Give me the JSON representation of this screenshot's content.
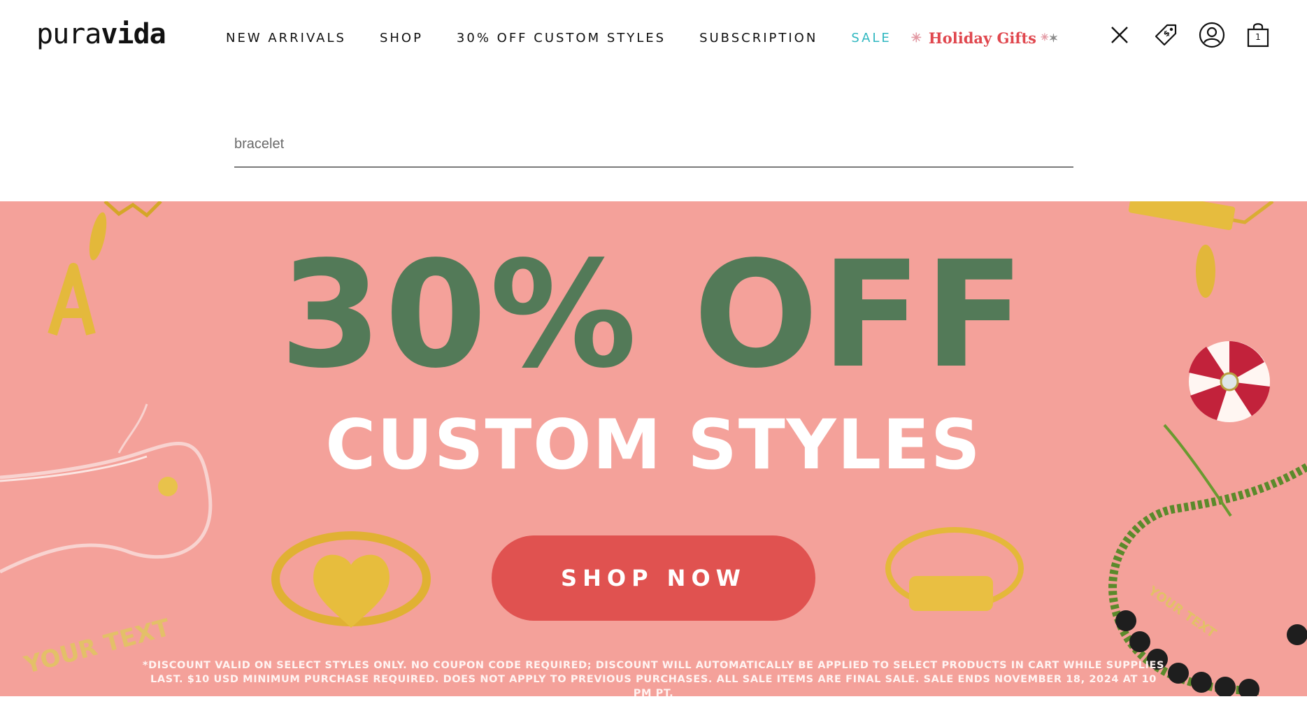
{
  "brand": {
    "logo_regular": "pura",
    "logo_bold": "vida"
  },
  "nav": {
    "items": [
      {
        "label": "NEW ARRIVALS"
      },
      {
        "label": "SHOP"
      },
      {
        "label": "30% OFF CUSTOM STYLES"
      },
      {
        "label": "SUBSCRIPTION"
      },
      {
        "label": "SALE"
      }
    ],
    "holiday": {
      "label": "Holiday Gifts"
    },
    "sale_color": "#2fb7c0",
    "holiday_color": "#e0474e"
  },
  "header_icons": {
    "close": "close-icon",
    "rewards": "price-tag-icon",
    "account": "account-icon",
    "cart": "shopping-bag-icon",
    "cart_count": "1"
  },
  "search": {
    "value": "bracelet",
    "placeholder": ""
  },
  "banner": {
    "headline": "30% OFF",
    "subhead": "CUSTOM STYLES",
    "cta": "SHOP NOW",
    "disclaimer_line1": "*DISCOUNT VALID ON SELECT STYLES ONLY. NO COUPON CODE REQUIRED; DISCOUNT WILL AUTOMATICALLY BE APPLIED TO SELECT PRODUCTS IN CART WHILE SUPPLIES",
    "disclaimer_line2": "LAST. $10 USD MINIMUM PURCHASE REQUIRED. DOES NOT APPLY TO PREVIOUS PURCHASES. ALL SALE ITEMS ARE FINAL SALE. SALE ENDS NOVEMBER 18, 2024 AT 10 PM PT.",
    "bracelet_text_left": "YOUR TEXT",
    "bracelet_text_right": "YOUR TEXT",
    "charm_letter": "A",
    "background": "#f4a19a",
    "headline_color": "#537a58",
    "cta_color": "#e05250"
  }
}
